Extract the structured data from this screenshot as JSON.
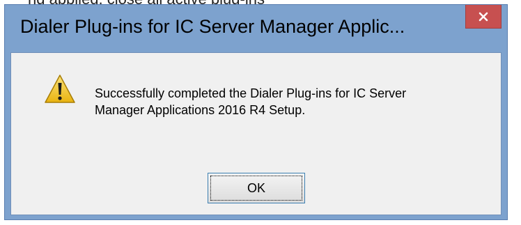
{
  "background": {
    "text": "ng applied, close all active plug-ins"
  },
  "dialog": {
    "title": "Dialer Plug-ins for IC Server Manager Applic...",
    "close_icon": "close-icon",
    "message_line1": "Successfully completed the Dialer Plug-ins for IC Server",
    "message_line2": "Manager Applications 2016 R4 Setup.",
    "icon": "warning-icon",
    "ok_label": "OK",
    "colors": {
      "frame": "#7da2ce",
      "close_button": "#c75050",
      "client": "#f0f0f0",
      "warning_fill": "#f2c82c"
    }
  }
}
